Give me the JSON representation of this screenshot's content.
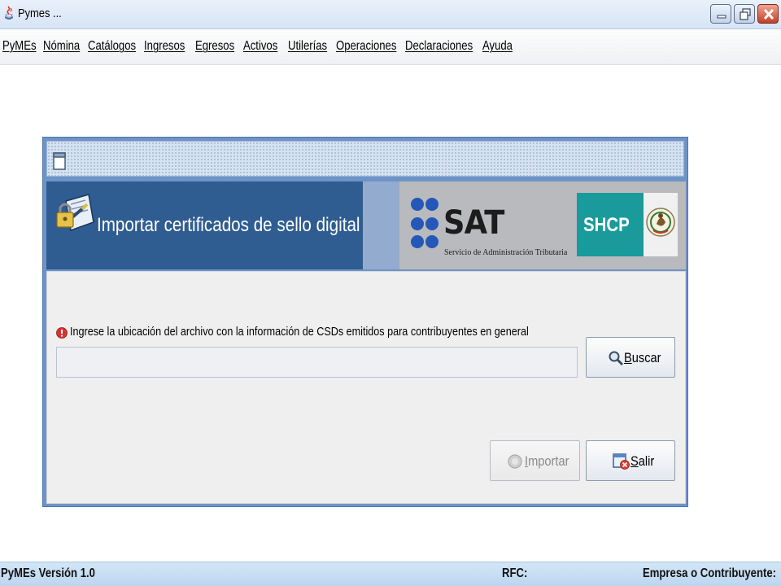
{
  "window": {
    "title": "Pymes ...",
    "icons": [
      "java-app-icon",
      "minimize-icon",
      "restore-icon",
      "close-icon"
    ]
  },
  "menu": {
    "items": [
      "PyMEs",
      "Nómina",
      "Catálogos",
      "Ingresos",
      "Egresos",
      "Activos",
      "Utilerías",
      "Operaciones",
      "Declaraciones",
      "Ayuda"
    ]
  },
  "dialog": {
    "heading": "Importar certificados de sello digital",
    "sat": {
      "name": "SAT",
      "subtitle": "Servicio de Administración Tributaria"
    },
    "shcp": "SHCP",
    "prompt": "Ingrese la ubicación del archivo con la información de CSDs emitidos para contribuyentes en general",
    "path_value": "",
    "buttons": {
      "buscar": {
        "mnemonic": "B",
        "rest": "uscar",
        "enabled": true
      },
      "importar": {
        "mnemonic": "I",
        "rest": "mportar",
        "enabled": false
      },
      "salir": {
        "mnemonic": "S",
        "rest": "alir",
        "enabled": true
      }
    },
    "colors": {
      "header_blue": "#2f5d91",
      "frame_blue": "#6d94c9",
      "shcp_teal": "#1a9a9a",
      "info_red": "#d9342b"
    }
  },
  "status": {
    "version": "PyMEs Versión 1.0",
    "rfc": "RFC:",
    "empresa": "Empresa o Contribuyente:"
  }
}
